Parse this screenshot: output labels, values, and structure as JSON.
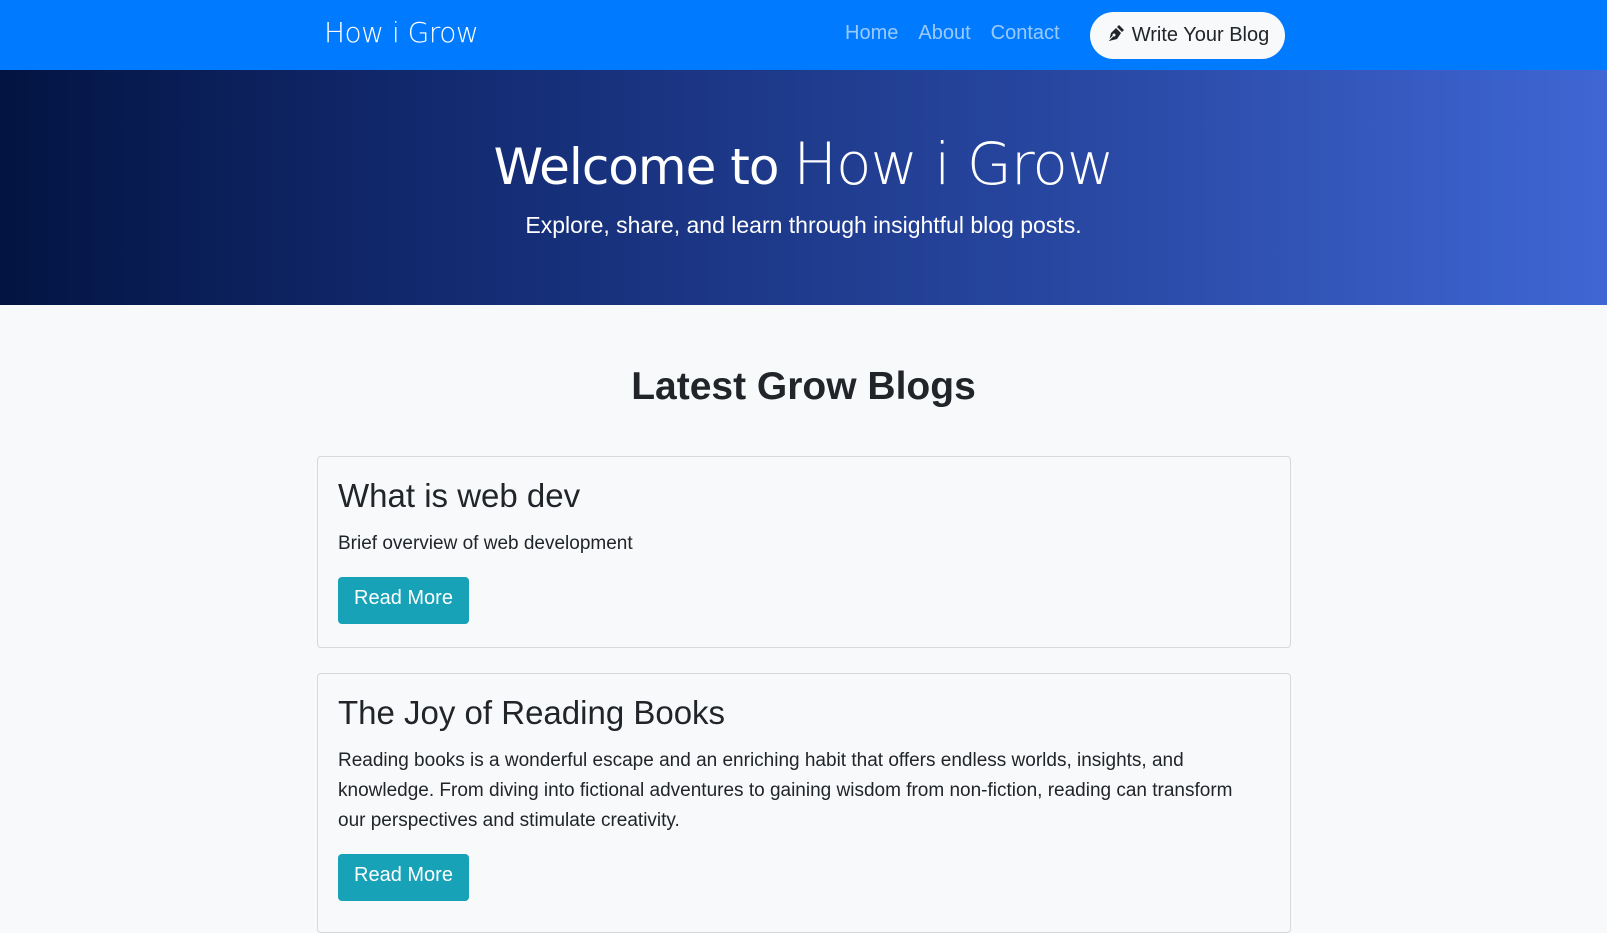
{
  "nav": {
    "brand": "How i Grow",
    "links": [
      "Home",
      "About",
      "Contact"
    ],
    "write_button": "Write Your Blog"
  },
  "hero": {
    "title_prefix": "Welcome to",
    "title_brand": "How i Grow",
    "subtitle": "Explore, share, and learn through insightful blog posts."
  },
  "section_title": "Latest Grow Blogs",
  "posts": [
    {
      "title": "What is web dev",
      "summary": "Brief overview of web development",
      "button": "Read More"
    },
    {
      "title": "The Joy of Reading Books",
      "summary": "Reading books is a wonderful escape and an enriching habit that offers endless worlds, insights, and knowledge. From diving into fictional adventures to gaining wisdom from non-fiction, reading can transform our perspectives and stimulate creativity.",
      "button": "Read More"
    }
  ]
}
